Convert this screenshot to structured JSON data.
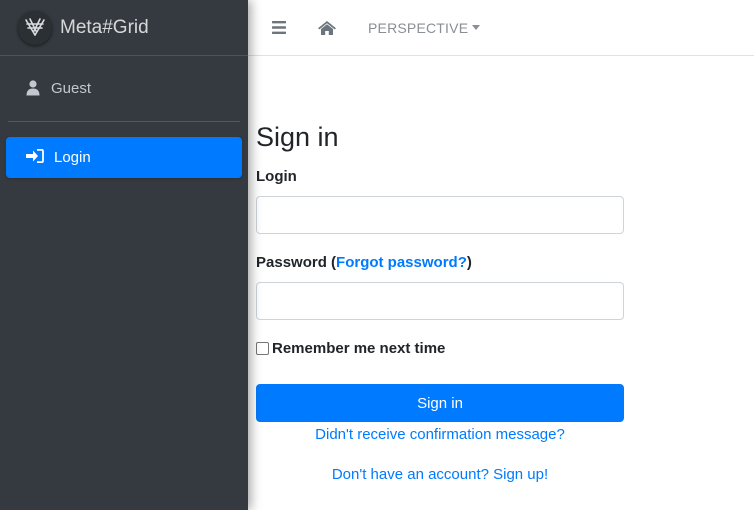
{
  "brand": {
    "name": "Meta#Grid",
    "logo_icon": "metagrid-logo-icon"
  },
  "sidebar": {
    "user": {
      "name": "Guest",
      "icon": "user-icon"
    },
    "items": [
      {
        "label": "Login",
        "icon": "sign-in-icon",
        "active": true
      }
    ]
  },
  "topbar": {
    "menu_icon": "bars-icon",
    "home_icon": "home-icon",
    "perspective_label": "PERSPECTIVE"
  },
  "form": {
    "title": "Sign in",
    "login_label": "Login",
    "login_value": "",
    "password_label_prefix": "Password (",
    "forgot_link": "Forgot password?",
    "password_label_suffix": ")",
    "password_value": "",
    "remember_label": "Remember me next time",
    "remember_checked": false,
    "submit_label": "Sign in",
    "confirmation_link": "Didn't receive confirmation message?",
    "signup_link": "Don't have an account? Sign up!"
  },
  "colors": {
    "accent": "#007bff",
    "sidebar_bg": "#343a40",
    "sidebar_text": "#c2c7d0"
  }
}
